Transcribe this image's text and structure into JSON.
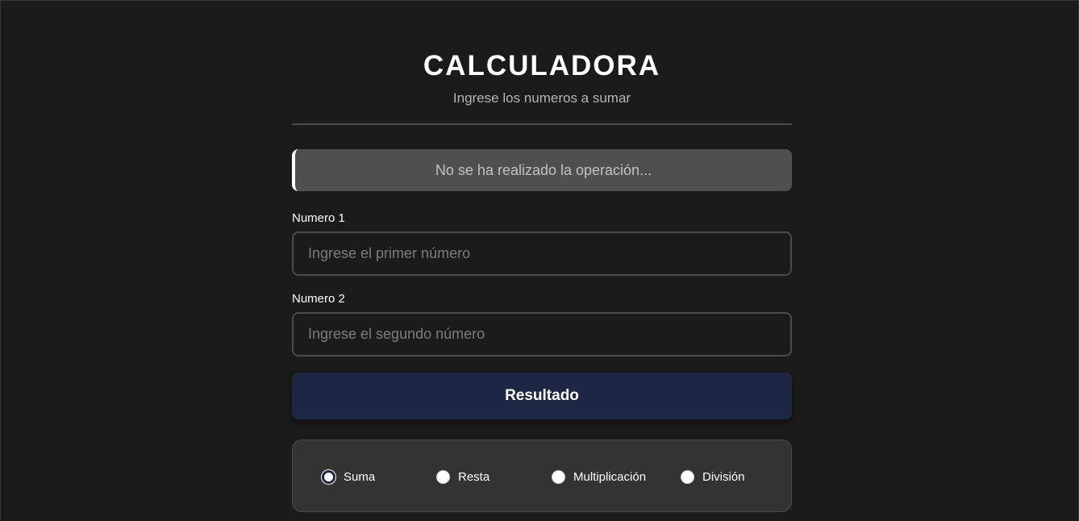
{
  "header": {
    "title": "CALCULADORA",
    "subtitle": "Ingrese los numeros a sumar"
  },
  "status": {
    "message": "No se ha realizado la operación..."
  },
  "form": {
    "number1": {
      "label": "Numero 1",
      "value": "",
      "placeholder": "Ingrese el primer número"
    },
    "number2": {
      "label": "Numero 2",
      "value": "",
      "placeholder": "Ingrese el segundo número"
    },
    "submit_label": "Resultado"
  },
  "operations": {
    "selected": "Suma",
    "options": [
      "Suma",
      "Resta",
      "Multiplicación",
      "División"
    ]
  },
  "colors": {
    "background": "#1b1b1b",
    "button": "#1d2744",
    "status_background": "#4f4f4f",
    "operations_panel": "#333333"
  }
}
